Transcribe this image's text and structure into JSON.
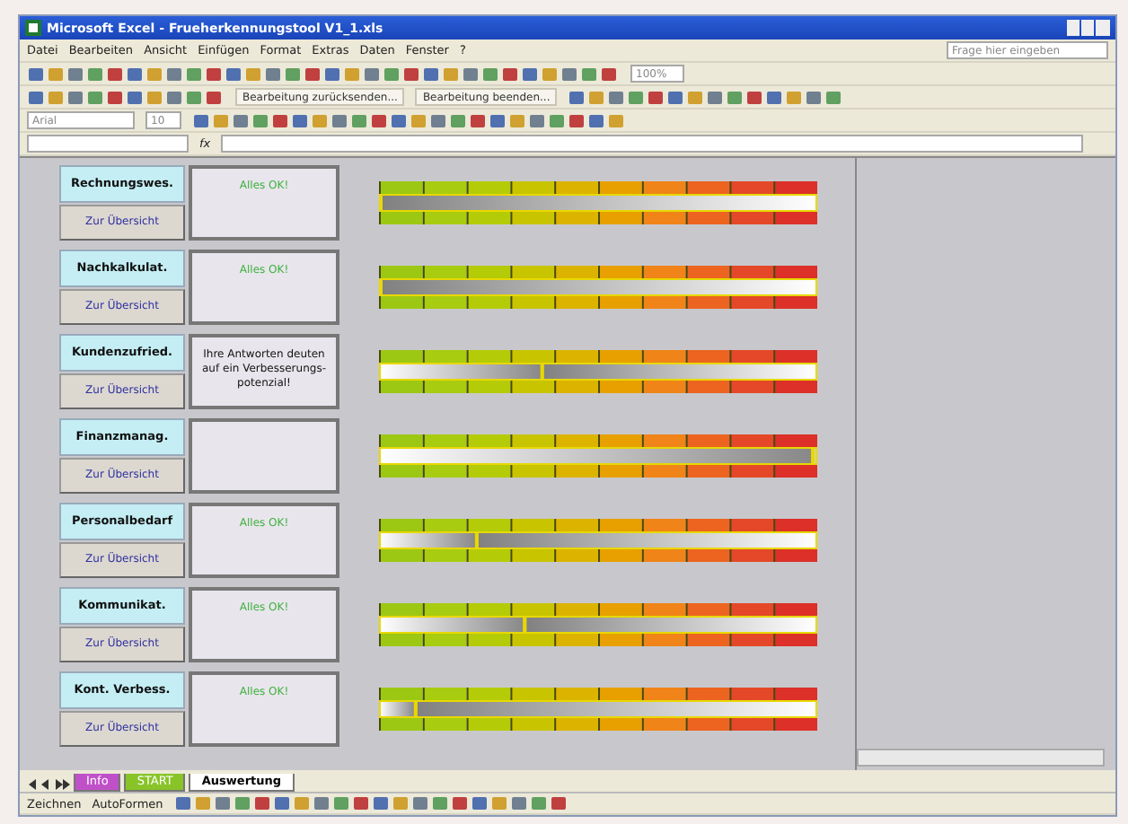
{
  "window": {
    "title": "Microsoft Excel - Frueherkennungstool V1_1.xls"
  },
  "menu": [
    "Datei",
    "Bearbeiten",
    "Ansicht",
    "Einfügen",
    "Format",
    "Extras",
    "Daten",
    "Fenster",
    "?"
  ],
  "help_search": {
    "placeholder": "Frage hier eingeben"
  },
  "toolbar": {
    "zoom": "100%",
    "review_buttons": [
      "Bearbeitung zurücksenden...",
      "Bearbeitung beenden..."
    ],
    "font": "Arial",
    "font_size": "10"
  },
  "formula_bar": {
    "function_label": "fx"
  },
  "areas": [
    {
      "name": "Rechnungswes.",
      "button": "Zur Übersicht",
      "message": {
        "text": "Alles OK!",
        "color": "#40b040"
      },
      "level": 0
    },
    {
      "name": "Nachkalkulat.",
      "button": "Zur Übersicht",
      "message": {
        "text": "Alles OK!",
        "color": "#40b040"
      },
      "level": 0
    },
    {
      "name": "Kundenzufried.",
      "button": "Zur Übersicht",
      "message": {
        "text": "Ihre Antworten deuten auf ein Verbesserungs-potenzial!",
        "color": "#111111"
      },
      "level": 0.37
    },
    {
      "name": "Finanzmanag.",
      "button": "Zur Übersicht",
      "level": 0.99
    },
    {
      "name": "Personalbedarf",
      "button": "Zur Übersicht",
      "message": {
        "text": "Alles OK!",
        "color": "#40b040"
      },
      "level": 0.22
    },
    {
      "name": "Kommunikat.",
      "button": "Zur Übersicht",
      "message": {
        "text": "Alles OK!",
        "color": "#40b040"
      },
      "level": 0.33
    },
    {
      "name": "Kont. Verbess.",
      "button": "Zur Übersicht",
      "message": {
        "text": "Alles OK!",
        "color": "#40b040"
      },
      "level": 0.08
    }
  ],
  "sheet_tabs": [
    {
      "label": "Info",
      "color": "#c050c8",
      "selected": false
    },
    {
      "label": "START",
      "color": "#88c428",
      "selected": false
    },
    {
      "label": "Auswertung",
      "selected": true
    }
  ],
  "drawing_toolbar": [
    "Zeichnen",
    "AutoFormen"
  ]
}
